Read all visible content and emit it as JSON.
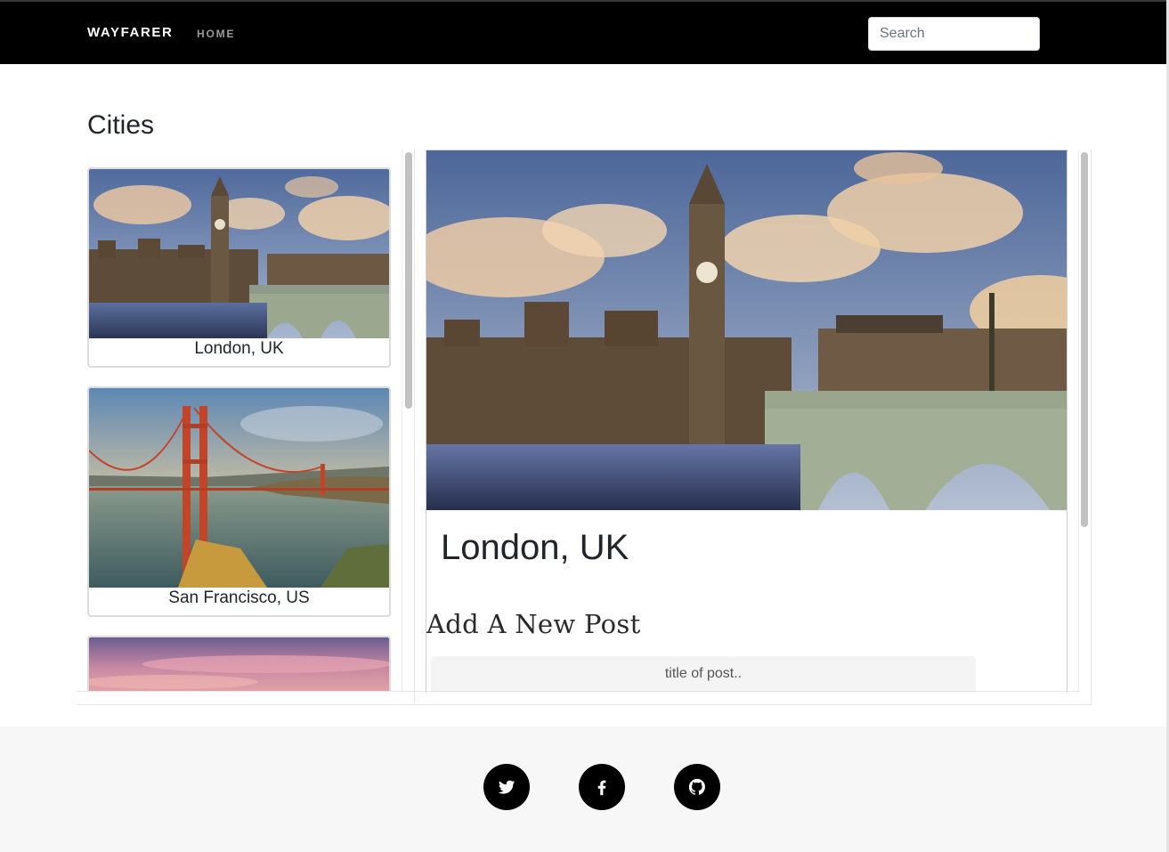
{
  "navbar": {
    "brand": "WAYFARER",
    "home_label": "HOME",
    "search_placeholder": "Search"
  },
  "main": {
    "title": "Cities",
    "cities": [
      {
        "name": "London, UK",
        "image": "london-photo"
      },
      {
        "name": "San Francisco, US",
        "image": "golden-gate-photo"
      },
      {
        "name": "",
        "image": "sunset-sky-photo"
      }
    ]
  },
  "detail": {
    "city_name": "London, UK",
    "image": "london-photo",
    "new_post_heading": "Add A New Post",
    "title_placeholder": "title of post.."
  },
  "footer": {
    "social": [
      {
        "name": "twitter-icon"
      },
      {
        "name": "facebook-icon"
      },
      {
        "name": "github-icon"
      }
    ]
  },
  "colors": {
    "navbar_bg": "#000000",
    "footer_bg": "#f7f7f7",
    "social_bg": "#000000"
  }
}
